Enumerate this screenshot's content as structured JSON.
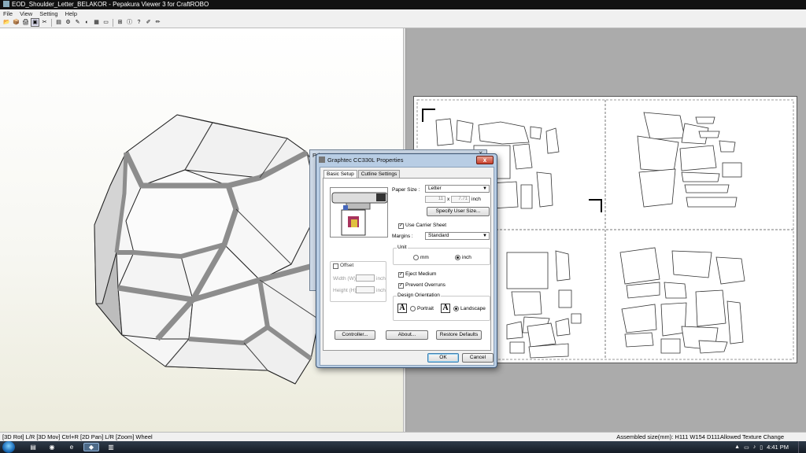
{
  "window": {
    "title": "EOD_Shoulder_Letter_BELAKOR - Pepakura Viewer 3 for CraftROBO"
  },
  "menu": [
    "File",
    "View",
    "Setting",
    "Help"
  ],
  "toolbar": {
    "icons": [
      "open-icon",
      "3d-model-icon",
      "print-icon",
      "print-setup-icon",
      "cut-icon",
      "page-icon",
      "settings-icon",
      "wand-icon",
      "color-icon",
      "grid-icon",
      "layout-icon",
      "zoom-icon",
      "info-icon",
      "help-icon",
      "pen-icon",
      "pencil-icon"
    ],
    "glyphs": [
      "📂",
      "📦",
      "🖨",
      "▣",
      "✂",
      "▤",
      "⚙",
      "✎",
      "◐",
      "▦",
      "▭",
      "⊞",
      "ⓘ",
      "?",
      "✐",
      "✏"
    ],
    "active_index": 3
  },
  "status": {
    "left": "[3D Rot] L/R [3D Mov] Ctrl+R [2D Pan] L/R [Zoom] Wheel",
    "right": "Assembled size(mm): H111 W154 D111Allowed Texture Change"
  },
  "print_dialog": {
    "title": "Print"
  },
  "properties_dialog": {
    "title": "Graphtec CC330L Properties",
    "close_glyph": "x",
    "tabs": [
      "Basic Setup",
      "Cutline Settings"
    ],
    "paper_size_label": "Paper Size :",
    "paper_size_value": "Letter",
    "width_value": "11",
    "height_value": "7.71",
    "x_sep": "x",
    "size_unit": "inch",
    "specify_user_size_label": "Specify User Size...",
    "use_carrier_sheet_label": "Use Carrier Sheet",
    "use_carrier_sheet_checked": true,
    "margins_label": "Margins :",
    "margins_value": "Standard",
    "unit_group_label": "Unit",
    "unit_mm_label": "mm",
    "unit_inch_label": "inch",
    "unit_selected": "inch",
    "offset_label": "Offset",
    "offset_checked": false,
    "offset_width_label": "Width (W)",
    "offset_height_label": "Height (H)",
    "offset_unit": "inch",
    "eject_medium_label": "Eject Medium",
    "eject_medium_checked": true,
    "prevent_overruns_label": "Prevent Overruns",
    "prevent_overruns_checked": true,
    "orientation_group_label": "Design Orientation",
    "portrait_label": "Portrait",
    "landscape_label": "Landscape",
    "orientation_selected": "Landscape",
    "orientation_glyph": "A",
    "controller_label": "Controller...",
    "about_label": "About...",
    "restore_defaults_label": "Restore Defaults",
    "ok_label": "OK",
    "cancel_label": "Cancel"
  },
  "taskbar": {
    "clock": "4:41 PM",
    "apps": [
      "explorer-icon",
      "chrome-icon",
      "ie-icon",
      "pepakura-icon",
      "printer-icon"
    ],
    "app_glyphs": [
      "▤",
      "◉",
      "e",
      "◆",
      "▥"
    ],
    "tray_icons": [
      "arrow-up-icon",
      "monitor-icon",
      "speaker-icon",
      "network-icon"
    ],
    "tray_glyphs": [
      "▲",
      "▭",
      "♪",
      "▯"
    ]
  }
}
